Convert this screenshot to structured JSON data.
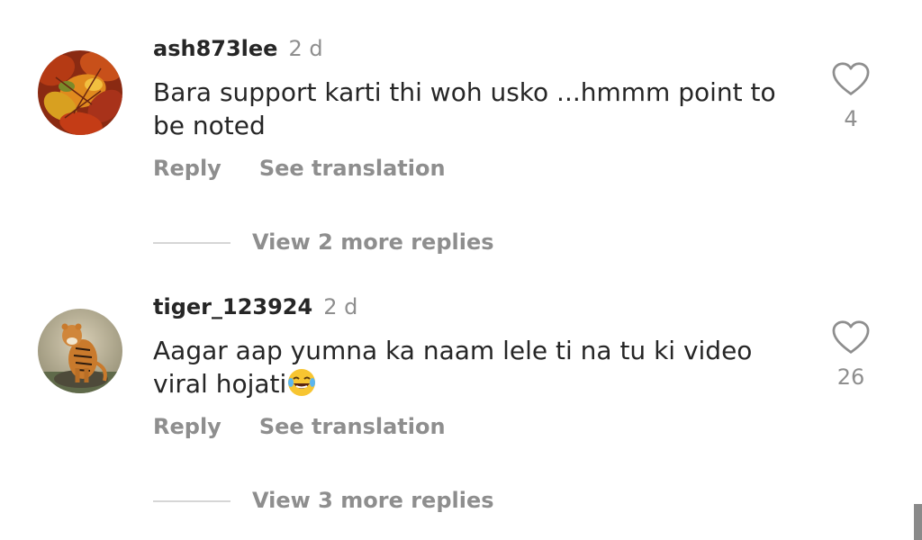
{
  "comments": [
    {
      "username": "ash873lee",
      "time": "2 d",
      "text": "Bara support karti thi woh usko ...hmmm point to be noted",
      "likes": "4",
      "reply_label": "Reply",
      "translate_label": "See translation",
      "view_replies": "View 2 more replies",
      "avatar_icon": "autumn-leaves-icon"
    },
    {
      "username": "tiger_123924",
      "time": "2 d",
      "text": "Aagar aap yumna ka naam lele ti na tu ki video viral hojati",
      "emoji": "laughing-crying-emoji",
      "likes": "26",
      "reply_label": "Reply",
      "translate_label": "See translation",
      "view_replies": "View 3 more replies",
      "avatar_icon": "tiger-icon"
    }
  ],
  "colors": {
    "primary_text": "#262626",
    "secondary_text": "#8e8e8e",
    "divider": "#d6d6d6"
  }
}
